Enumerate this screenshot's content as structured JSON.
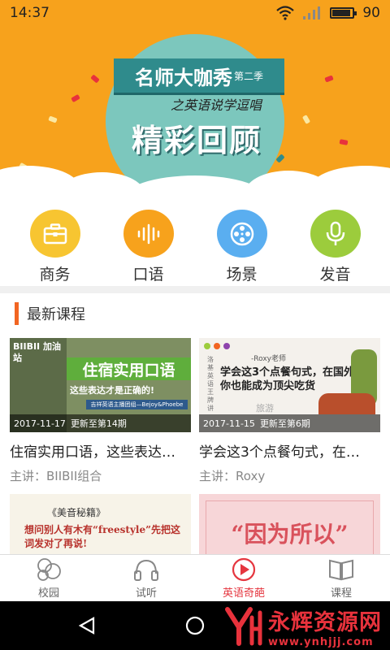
{
  "status_bar": {
    "time": "14:37",
    "battery": "90",
    "battery_level": 0.9
  },
  "banner": {
    "ribbon_title": "名师大咖秀",
    "ribbon_season": "第二季",
    "subtitle": "之英语说学逗唱",
    "headline": "精彩回顾"
  },
  "categories": [
    {
      "label": "商务",
      "icon": "briefcase-icon",
      "color": "#f7c531"
    },
    {
      "label": "口语",
      "icon": "soundwave-icon",
      "color": "#f7a21c"
    },
    {
      "label": "场景",
      "icon": "film-reel-icon",
      "color": "#5aaef0"
    },
    {
      "label": "发音",
      "icon": "microphone-icon",
      "color": "#9ccc3c"
    }
  ],
  "section": {
    "title": "最新课程",
    "accent": "#f26522"
  },
  "courses": [
    {
      "title": "住宿实用口语，这些表达…",
      "teacher": "主讲：BIIBII组合",
      "date": "2017-11-17",
      "update": "更新至第14期",
      "thumb_heading": "住宿实用口语",
      "thumb_sub": "这些表达才是正确的!",
      "thumb_tag": "BIIBII 加油站",
      "thumb_byline": "吉祥英语主播团组—Bejoy&Phoebe"
    },
    {
      "title": "学会这3个点餐句式，在…",
      "teacher": "主讲：Roxy",
      "date": "2017-11-15",
      "update": "更新至第6期",
      "thumb_heading": "学会这3个点餐句式，在国外你也能成为顶尖吃货",
      "thumb_author": "-Roxy老师",
      "thumb_side": "旅游",
      "thumb_vertical": "洛基英语王牌讲"
    },
    {
      "thumb_heading": "想问别人有木有“freestyle”先把这词发对了再说!",
      "thumb_tag": "《美音秘籍》"
    },
    {
      "thumb_heading": "“因为所以”"
    }
  ],
  "nav": [
    {
      "label": "校园",
      "icon": "campus-icon",
      "active": false
    },
    {
      "label": "试听",
      "icon": "headphones-icon",
      "active": false
    },
    {
      "label": "英语奇葩",
      "icon": "play-circle-icon",
      "active": true
    },
    {
      "label": "课程",
      "icon": "book-icon",
      "active": false
    }
  ],
  "watermark": {
    "name": "永辉资源网",
    "url": "www.ynhjjj.com"
  },
  "colors": {
    "primary": "#f7a21c",
    "active_nav": "#e5363f"
  }
}
